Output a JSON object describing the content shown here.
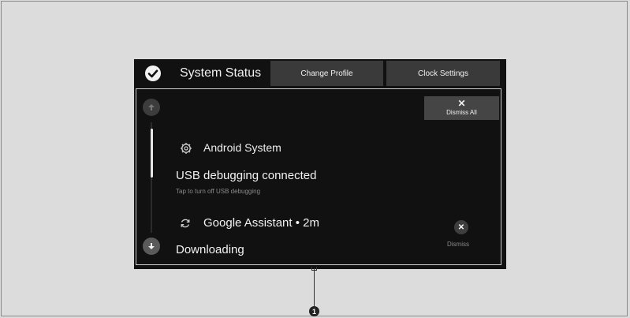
{
  "header": {
    "title": "System Status",
    "tabs": [
      {
        "label": "Change Profile"
      },
      {
        "label": "Clock Settings"
      }
    ]
  },
  "panel": {
    "dismiss_all": {
      "icon": "close-icon",
      "symbol": "✕",
      "label": "Dismiss All"
    },
    "notifications": [
      {
        "app": "Android System",
        "icon": "gear-icon",
        "title": "USB debugging connected",
        "subtitle": "Tap to turn off USB debugging"
      },
      {
        "app": "Google Assistant • 2m",
        "icon": "sync-icon",
        "title": "Downloading",
        "dismiss_symbol": "✕",
        "dismiss_label": "Dismiss"
      }
    ]
  },
  "callout": {
    "number": "1"
  },
  "colors": {
    "background": "#dcdcdc",
    "screen": "#111111",
    "tab": "#3a3a3a",
    "accent_border": "#cfcfcf"
  }
}
